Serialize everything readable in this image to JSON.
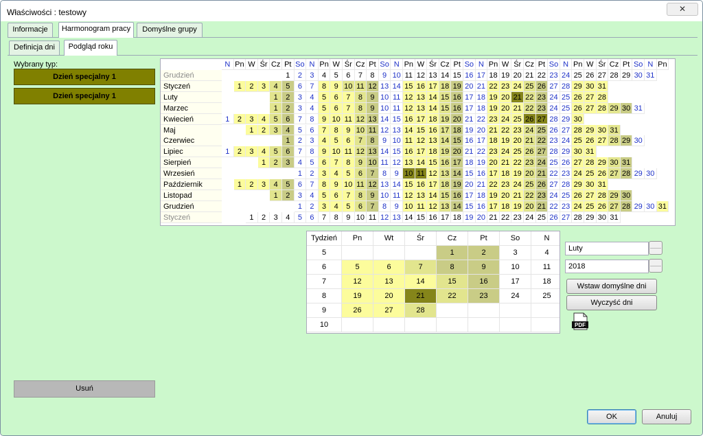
{
  "window": {
    "title": "Właściwości : testowy",
    "close_glyph": "✕"
  },
  "tabs": [
    "Informacje",
    "Harmonogram pracy",
    "Domyślne grupy"
  ],
  "subtabs": [
    "Definicja dni",
    "Podgląd roku"
  ],
  "left": {
    "label": "Wybrany typ:",
    "type_buttons": [
      "Dzień specjalny 1",
      "Dzień specjalny 1"
    ],
    "delete_label": "Usuń",
    "type_color": "#808000"
  },
  "colors": {
    "weekend_text": "#1f32c8",
    "light_yellow": "#fcfc9c",
    "mid_yellow": "#e2e58e",
    "olive_light": "#c9cc86",
    "olive_dark": "#85851a",
    "panel_bg": "#ccf8cc"
  },
  "year_view": {
    "header": [
      "N",
      "Pn",
      "Wt",
      "Śr",
      "Cz",
      "Pt",
      "So",
      "N",
      "Pn",
      "Wt",
      "Śr",
      "Cz",
      "Pt",
      "So",
      "N",
      "Pn",
      "Wt",
      "Śr",
      "Cz",
      "Pt",
      "So",
      "N",
      "Pn",
      "Wt",
      "Śr",
      "Cz",
      "Pt",
      "So",
      "N",
      "Pn",
      "Wt",
      "Śr",
      "Cz",
      "Pt",
      "So",
      "N",
      "Pn"
    ],
    "header_display": [
      "N",
      "Pn",
      "W",
      "Śr",
      "Cz",
      "Pt",
      "So",
      "N",
      "Pn",
      "W",
      "Śr",
      "Cz",
      "Pt",
      "So",
      "N",
      "Pn",
      "W",
      "Śr",
      "Cz",
      "Pt",
      "So",
      "N",
      "Pn",
      "W",
      "Śr",
      "Cz",
      "Pt",
      "So",
      "N",
      "Pn",
      "W",
      "Śr",
      "Cz",
      "Pt",
      "So",
      "N",
      "Pn"
    ],
    "months": [
      {
        "name": "Grudzień",
        "greyed": true,
        "offset": 5,
        "days": 31
      },
      {
        "name": "Styczeń",
        "greyed": false,
        "offset": 1,
        "days": 31
      },
      {
        "name": "Luty",
        "greyed": false,
        "offset": 4,
        "days": 28
      },
      {
        "name": "Marzec",
        "greyed": false,
        "offset": 4,
        "days": 31
      },
      {
        "name": "Kwiecień",
        "greyed": false,
        "offset": 0,
        "days": 30
      },
      {
        "name": "Maj",
        "greyed": false,
        "offset": 2,
        "days": 31
      },
      {
        "name": "Czerwiec",
        "greyed": false,
        "offset": 5,
        "days": 30
      },
      {
        "name": "Lipiec",
        "greyed": false,
        "offset": 0,
        "days": 31
      },
      {
        "name": "Sierpień",
        "greyed": false,
        "offset": 3,
        "days": 31
      },
      {
        "name": "Wrzesień",
        "greyed": false,
        "offset": 6,
        "days": 30
      },
      {
        "name": "Październik",
        "greyed": false,
        "offset": 1,
        "days": 31
      },
      {
        "name": "Listopad",
        "greyed": false,
        "offset": 4,
        "days": 30
      },
      {
        "name": "Grudzień",
        "greyed": false,
        "offset": 6,
        "days": 31
      },
      {
        "name": "Styczeń",
        "greyed": true,
        "offset": 2,
        "days": 31
      }
    ]
  },
  "month_view": {
    "headers": [
      "Tydzień",
      "Pn",
      "Wt",
      "Śr",
      "Cz",
      "Pt",
      "So",
      "N"
    ],
    "weeks": [
      {
        "week": "5",
        "days": [
          "",
          "",
          "",
          "1",
          "2",
          "3",
          "4"
        ]
      },
      {
        "week": "6",
        "days": [
          "5",
          "6",
          "7",
          "8",
          "9",
          "10",
          "11"
        ]
      },
      {
        "week": "7",
        "days": [
          "12",
          "13",
          "14",
          "15",
          "16",
          "17",
          "18"
        ]
      },
      {
        "week": "8",
        "days": [
          "19",
          "20",
          "21",
          "22",
          "23",
          "24",
          "25"
        ]
      },
      {
        "week": "9",
        "days": [
          "26",
          "27",
          "28",
          "",
          "",
          "",
          ""
        ]
      },
      {
        "week": "10",
        "days": [
          "",
          "",
          "",
          "",
          "",
          "",
          ""
        ]
      }
    ],
    "selected_month": "Luty",
    "selected_year": "2018"
  },
  "actions": {
    "insert_default": "Wstaw domyślne dni",
    "clear_days": "Wyczyść dni",
    "pdf_label": "PDF",
    "ok": "OK",
    "cancel": "Anuluj"
  }
}
